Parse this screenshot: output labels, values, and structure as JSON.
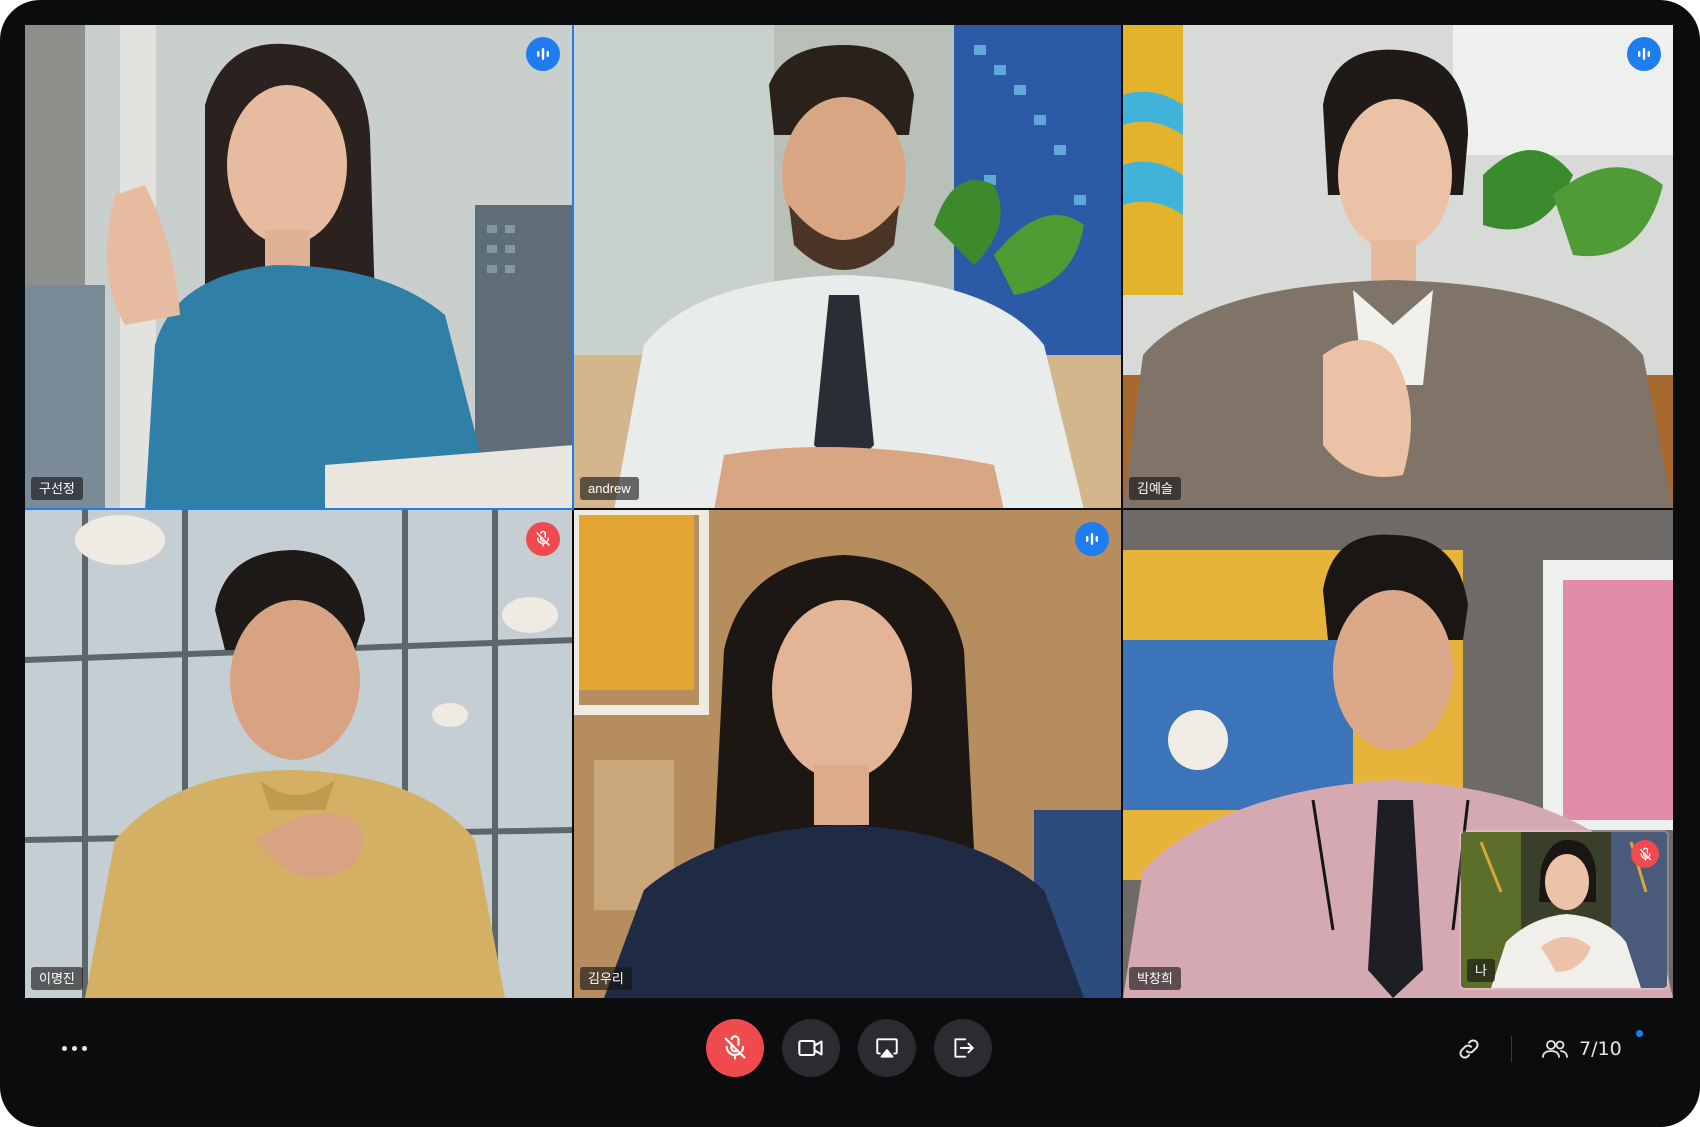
{
  "participants": [
    {
      "name": "구선정",
      "state": "speaking",
      "active": true
    },
    {
      "name": "andrew",
      "state": "none"
    },
    {
      "name": "김예슬",
      "state": "speaking"
    },
    {
      "name": "이명진",
      "state": "muted"
    },
    {
      "name": "김우리",
      "state": "speaking"
    },
    {
      "name": "박창희",
      "state": "none"
    }
  ],
  "self_view": {
    "name": "나",
    "state": "muted"
  },
  "toolbar": {
    "participant_count": "7/10"
  },
  "colors": {
    "accent": "#1f7df0",
    "mute_red": "#ef4b4f",
    "background": "#0b0c0e"
  },
  "icons": [
    "speaking-icon",
    "mic-off-icon",
    "more-icon",
    "video-icon",
    "airplay-icon",
    "exit-icon",
    "link-icon",
    "people-icon"
  ]
}
